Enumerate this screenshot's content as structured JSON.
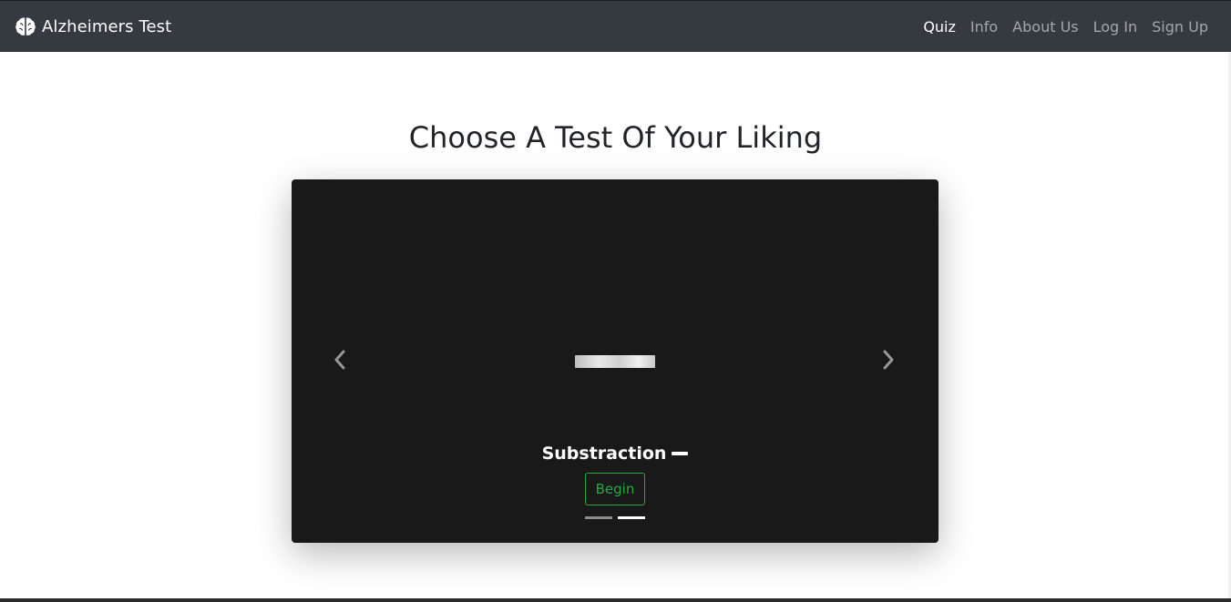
{
  "navbar": {
    "brand": "Alzheimers Test",
    "brand_icon": "brain-icon",
    "links": [
      {
        "label": "Quiz",
        "active": true
      },
      {
        "label": "Info",
        "active": false
      },
      {
        "label": "About Us",
        "active": false
      },
      {
        "label": "Log In",
        "active": false
      },
      {
        "label": "Sign Up",
        "active": false
      }
    ]
  },
  "main": {
    "heading": "Choose A Test Of Your Liking"
  },
  "carousel": {
    "slide_title": "Substraction",
    "slide_symbol_icon": "minus-icon",
    "begin_label": "Begin",
    "prev_icon": "chevron-left-icon",
    "next_icon": "chevron-right-icon",
    "slide_count": 2,
    "active_slide": 2,
    "button_color": "#28a745",
    "background_color": "#191919"
  }
}
